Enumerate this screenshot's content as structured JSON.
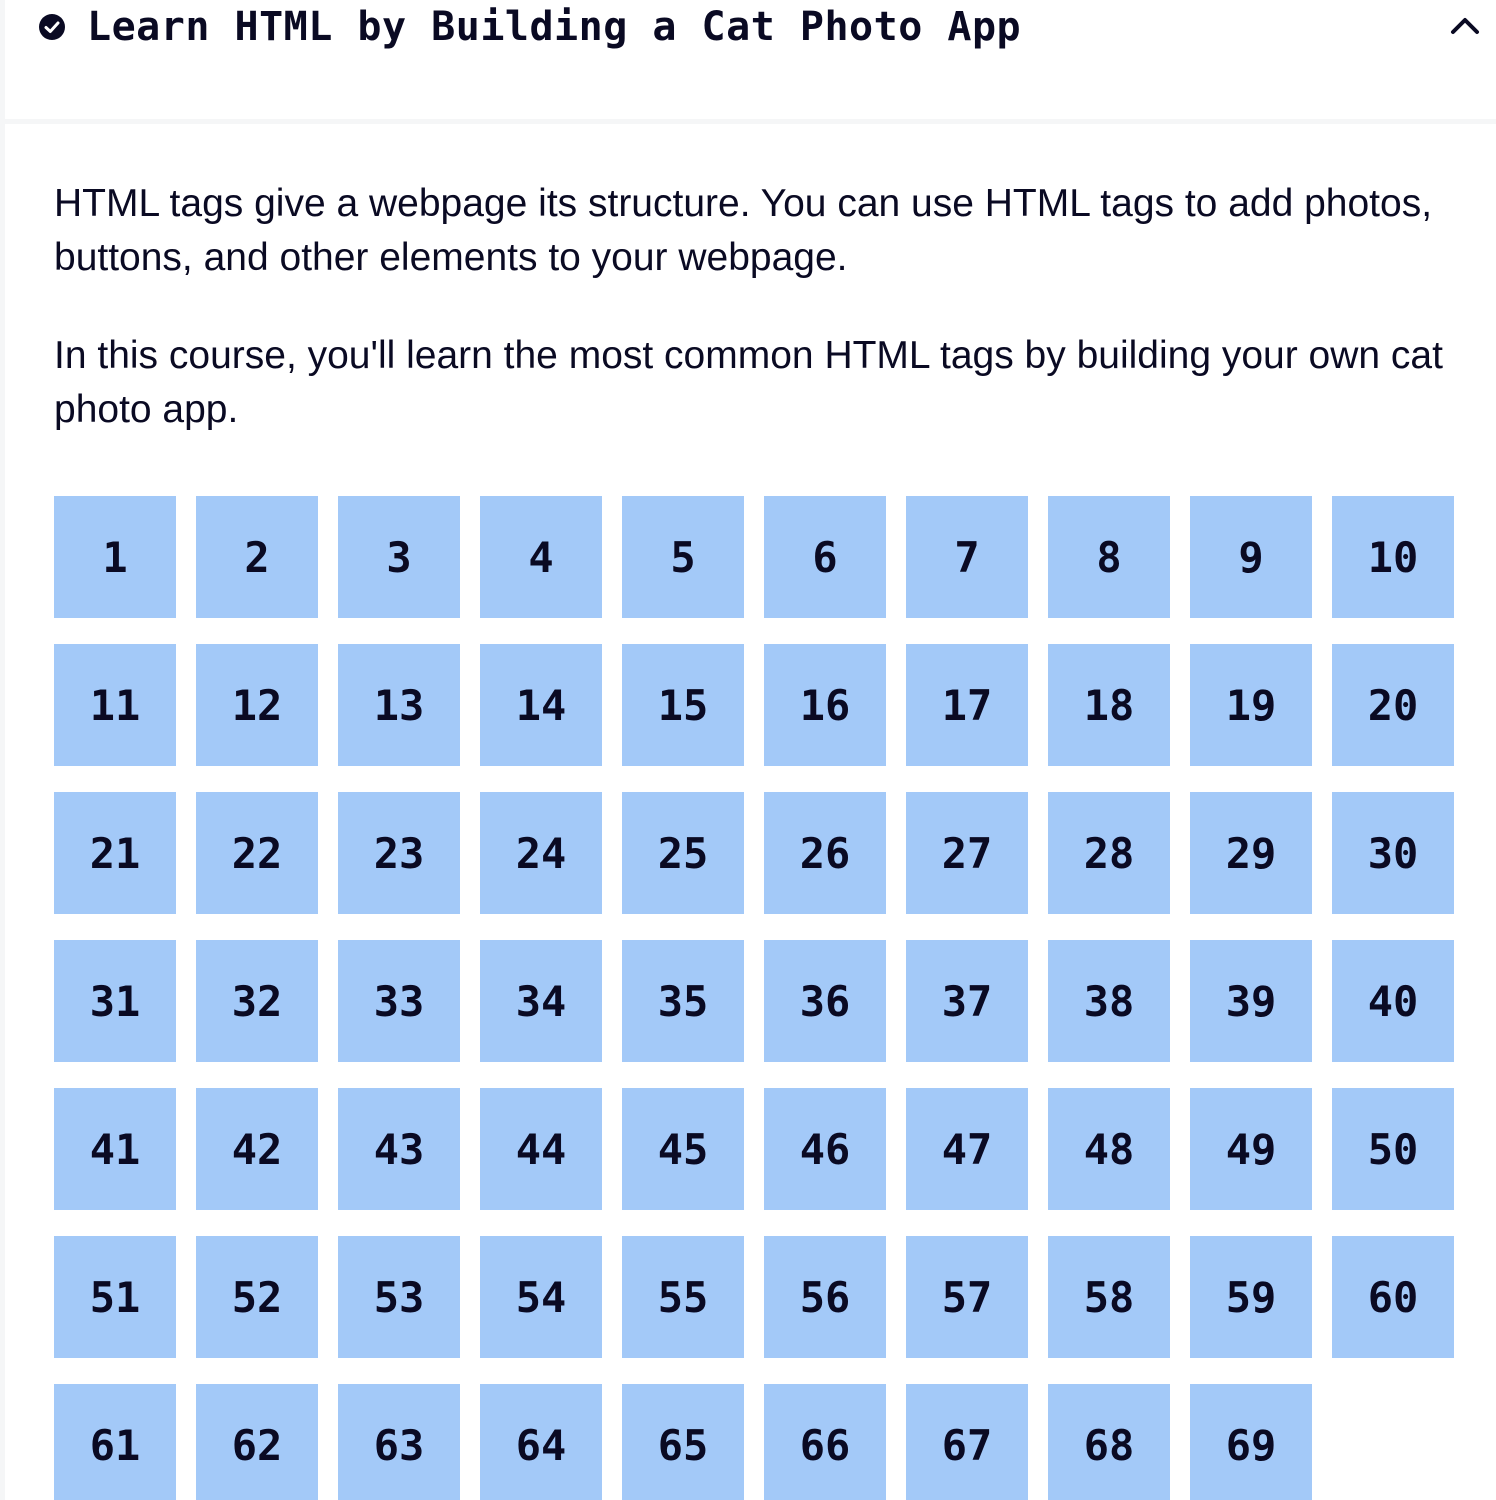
{
  "course": {
    "title": "Learn HTML by Building a Cat Photo App",
    "completed_icon": "check-circle-icon",
    "toggle_icon": "caret-up-icon"
  },
  "intro": {
    "paragraph_1": "HTML tags give a webpage its structure. You can use HTML tags to add photos, buttons, and other elements to your webpage.",
    "paragraph_2": "In this course, you'll learn the most common HTML tags by building your own cat photo app."
  },
  "steps": [
    "1",
    "2",
    "3",
    "4",
    "5",
    "6",
    "7",
    "8",
    "9",
    "10",
    "11",
    "12",
    "13",
    "14",
    "15",
    "16",
    "17",
    "18",
    "19",
    "20",
    "21",
    "22",
    "23",
    "24",
    "25",
    "26",
    "27",
    "28",
    "29",
    "30",
    "31",
    "32",
    "33",
    "34",
    "35",
    "36",
    "37",
    "38",
    "39",
    "40",
    "41",
    "42",
    "43",
    "44",
    "45",
    "46",
    "47",
    "48",
    "49",
    "50",
    "51",
    "52",
    "53",
    "54",
    "55",
    "56",
    "57",
    "58",
    "59",
    "60",
    "61",
    "62",
    "63",
    "64",
    "65",
    "66",
    "67",
    "68",
    "69"
  ],
  "colors": {
    "step_background": "#a3c9f8",
    "text": "#0a0a23",
    "divider": "#f5f6f7"
  }
}
